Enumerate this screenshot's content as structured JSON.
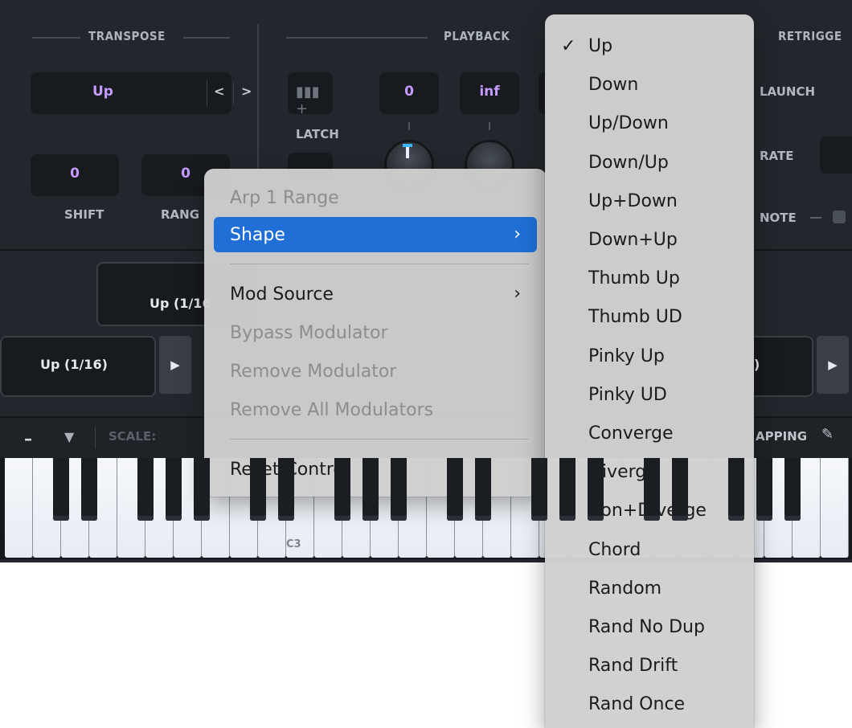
{
  "transpose": {
    "title": "TRANSPOSE",
    "mode_value": "Up",
    "shift_value": "0",
    "range_value": "0",
    "shift_label": "SHIFT",
    "range_label": "RANG"
  },
  "playback": {
    "title": "PLAYBACK",
    "latch_label": "LATCH",
    "field1_value": "0",
    "field2_value": "inf"
  },
  "retrigger": {
    "title": "RETRIGGE",
    "launch_label": "LAUNCH",
    "rate_label": "RATE",
    "note_label": "NOTE"
  },
  "pattern": {
    "center_label": "Up (1/16",
    "left_label": "Up (1/16)",
    "right_label": ")"
  },
  "toolbar": {
    "scale_label": "SCALE:",
    "mapping_label": "APPING"
  },
  "keyboard": {
    "c3_label": "C3"
  },
  "context_menu": {
    "title": "Arp 1 Range",
    "shape_label": "Shape",
    "mod_source_label": "Mod Source",
    "bypass_label": "Bypass Modulator",
    "remove_label": "Remove Modulator",
    "remove_all_label": "Remove All Modulators",
    "reset_label": "Reset Control"
  },
  "shape_menu": {
    "selected": "Up",
    "items": [
      "Up",
      "Down",
      "Up/Down",
      "Down/Up",
      "Up+Down",
      "Down+Up",
      "Thumb Up",
      "Thumb UD",
      "Pinky Up",
      "Pinky UD",
      "Converge",
      "Diverge",
      "Con+Diverge",
      "Chord",
      "Random",
      "Rand No Dup",
      "Rand Drift",
      "Rand Once"
    ]
  },
  "colors": {
    "accent_purple": "#c69bff",
    "menu_highlight": "#1f6fd6",
    "panel_bg": "#23272d"
  }
}
